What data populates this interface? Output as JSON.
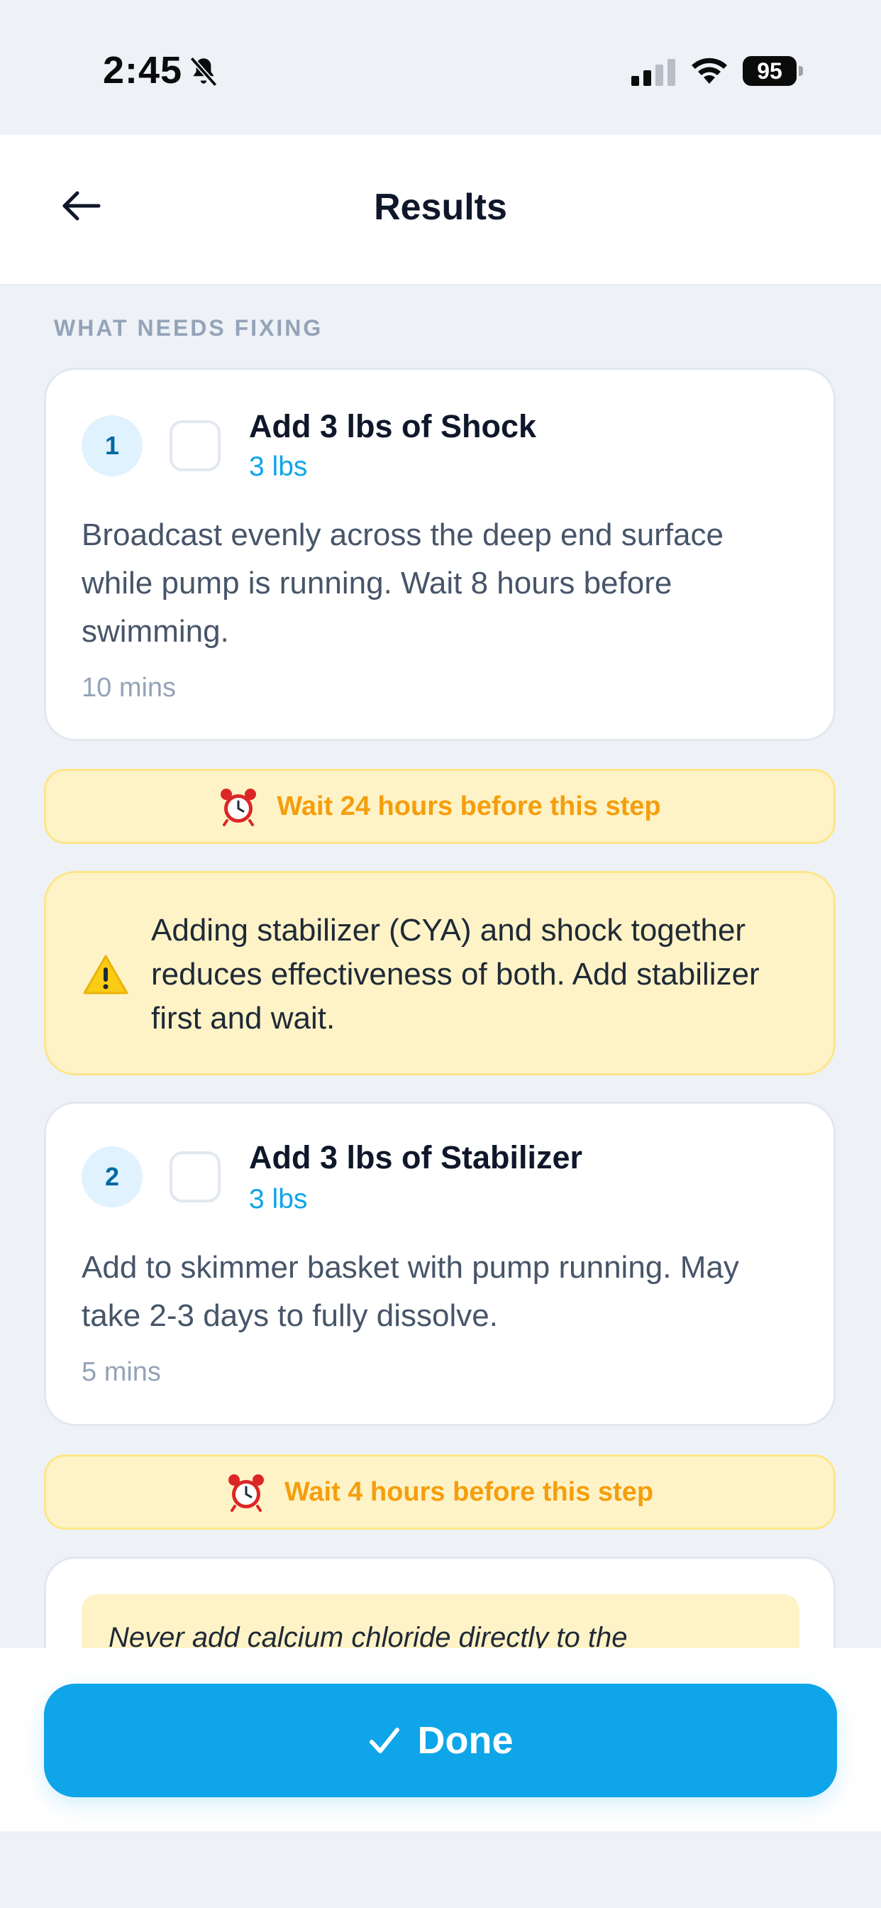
{
  "status_bar": {
    "time": "2:45",
    "battery": "95",
    "icons": [
      "bell-slash-icon",
      "cellular-signal-icon",
      "wifi-icon",
      "battery-icon"
    ]
  },
  "header": {
    "title": "Results",
    "back_icon": "arrow-left-icon"
  },
  "section": {
    "label": "WHAT NEEDS FIXING"
  },
  "steps": [
    {
      "number": "1",
      "title": "Add 3 lbs of Shock",
      "quantity": "3 lbs",
      "description": "Broadcast evenly across the deep end surface while pump is running. Wait 8 hours before swimming.",
      "time": "10 mins",
      "checked": false
    },
    {
      "number": "2",
      "title": "Add 3 lbs of Stabilizer",
      "quantity": "3 lbs",
      "description": "Add to skimmer basket with pump running. May take 2-3 days to fully dissolve.",
      "time": "5 mins",
      "checked": false
    }
  ],
  "waits": [
    {
      "text": "Wait 24 hours before this step",
      "icon": "alarm-clock-icon"
    },
    {
      "text": "Wait 4 hours before this step",
      "icon": "alarm-clock-icon"
    }
  ],
  "warning": {
    "icon": "warning-triangle-icon",
    "text": "Adding stabilizer (CYA) and shock together reduces effectiveness of both. Add stabilizer first and wait."
  },
  "step3_note": {
    "text": "Never add calcium chloride directly to the"
  },
  "done_button": {
    "label": "Done",
    "icon": "checkmark-icon"
  },
  "colors": {
    "accent": "#0EA5E9",
    "warning_bg": "#FEF3C7",
    "warning_text": "#F59E0B",
    "background": "#EEF2F7"
  }
}
